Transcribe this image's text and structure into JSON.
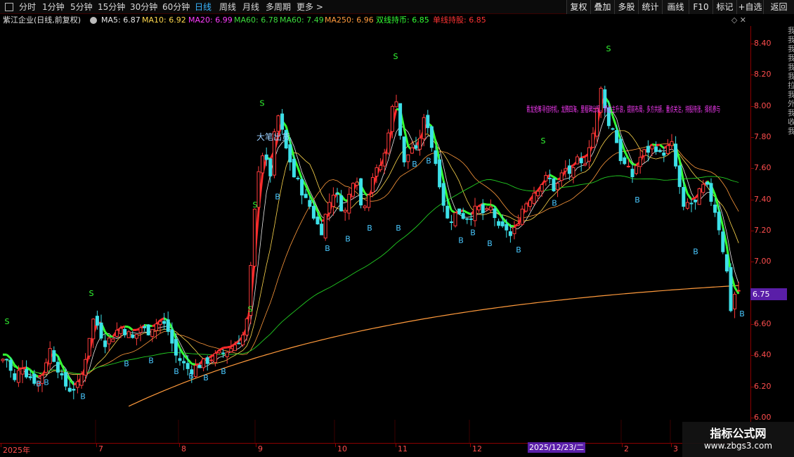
{
  "toolbar": {
    "periods": [
      {
        "label": "分时",
        "active": false
      },
      {
        "label": "1分钟",
        "active": false
      },
      {
        "label": "5分钟",
        "active": false
      },
      {
        "label": "15分钟",
        "active": false
      },
      {
        "label": "30分钟",
        "active": false
      },
      {
        "label": "60分钟",
        "active": false
      },
      {
        "label": "日线",
        "active": true
      },
      {
        "label": "周线",
        "active": false
      },
      {
        "label": "月线",
        "active": false
      },
      {
        "label": "多周期",
        "active": false
      },
      {
        "label": "更多 >",
        "active": false
      }
    ],
    "buttons": [
      "复权",
      "叠加",
      "多股",
      "统计",
      "画线",
      "F10",
      "标记",
      "+自选",
      "返回"
    ]
  },
  "ma_bar": {
    "title": "紫江企业(日线,前复权)",
    "items": [
      {
        "text": "MA5: 6.87",
        "color": "#e8e8e8"
      },
      {
        "text": "MA10: 6.92",
        "color": "#ffd84d"
      },
      {
        "text": "MA20: 6.99",
        "color": "#ff3cff"
      },
      {
        "text": "MA60: 6.78",
        "color": "#3cdc3c"
      },
      {
        "text": "MA60: 7.49",
        "color": "#3cdc3c"
      },
      {
        "text": "MA250: 6.96",
        "color": "#ff9a3c"
      },
      {
        "text": "双线持币: 6.85",
        "color": "#33ff33"
      },
      {
        "text": "单线持股: 6.85",
        "color": "#ff3333"
      }
    ],
    "icons": "◇ ✕"
  },
  "y_axis": [
    "8.40",
    "8.20",
    "8.00",
    "7.80",
    "7.60",
    "7.40",
    "7.20",
    "7.00",
    "6.80",
    "6.60",
    "6.40",
    "6.20",
    "6.00"
  ],
  "x_axis": [
    "2025年",
    "7",
    "8",
    "9",
    "10",
    "11",
    "12",
    "2",
    "3"
  ],
  "date_tag": "2025/12/23/二",
  "price_tag": "6.75",
  "right_strip_text": "我我我我我我拉我外我收我",
  "annotation_big": "大笔出货",
  "annotation_magenta": "青龙抢筹寻佳时机，龙腾四海，里程碑出现，抓住主升浪，提前布局，多方共振，重点关注，持股待涨，择机参与",
  "signals": {
    "buy": "B",
    "sell": "S"
  },
  "watermark": {
    "title": "指标公式网",
    "url": "www.zbgs3.com"
  },
  "colors": {
    "up": "#ff3b3b",
    "down": "#3de0e8",
    "hold_line": "#ff2a2a",
    "cash_line": "#33ff33",
    "ma5": "#e8e8e8",
    "ma10": "#ffd84d",
    "ma20": "#ff9a3c",
    "ma60": "#22cc22",
    "ma250": "#ff9a3c",
    "buy_signal": "#49c8ff",
    "sell_signal": "#33ff33",
    "annotation": "#ff3cff"
  }
}
